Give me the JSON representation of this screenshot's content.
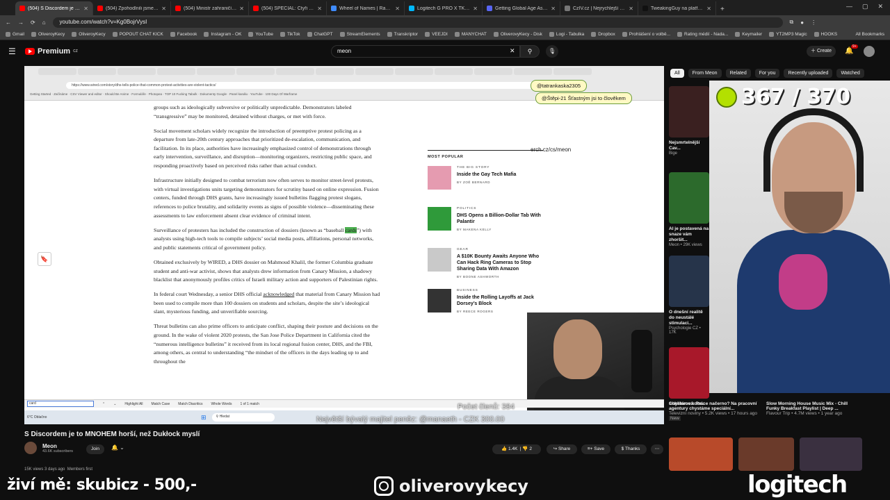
{
  "browser": {
    "tabs": [
      {
        "title": "(504) S Discordem je to MNOHEM horší",
        "color": "#ff0000"
      },
      {
        "title": "(504) Zpohodlnili jsme a rodiči...",
        "color": "#ff0000"
      },
      {
        "title": "(504) Ministr zahraničí Petr Mac...",
        "color": "#ff0000"
      },
      {
        "title": "(504) SPECIÁL: Čtyři roky války...",
        "color": "#ff0000"
      },
      {
        "title": "Wheel of Names | Random nam...",
        "color": "#3f8cff"
      },
      {
        "title": "Logitech G PRO X TKL Rapid, b...",
        "color": "#00b8fc"
      },
      {
        "title": "Getting Global Age Assurance...",
        "color": "#5865f2"
      },
      {
        "title": "CzIV.cz | Nejrychlejší ScreenSh...",
        "color": "#777777"
      },
      {
        "title": "TweakingGuy na platformě X: „...",
        "color": "#111111"
      }
    ],
    "url": "youtube.com/watch?v=Kg0BojrVysI",
    "bookmarks": [
      "Gmail",
      "OliveroyKecy",
      "OliveroyKecy",
      "POPOUT CHAT KICK",
      "Facebook",
      "Instagram - OK",
      "YouTube",
      "TikTok",
      "ChatGPT",
      "StreamElements",
      "Transkriptor",
      "VEEJDI",
      "MANYCHAT",
      "OliverovyKecy - Disk",
      "Logi - Tabulka",
      "Dropbox",
      "Prohlášení o volbě...",
      "Rating médií - Nada...",
      "Keymailer",
      "YT2MP3 Magic",
      "HOOKS"
    ],
    "all_bookmarks": "All Bookmarks"
  },
  "youtube": {
    "logo": "Premium",
    "logo_sup": "CZ",
    "search_value": "meon",
    "create_label": "Create",
    "notif_count": "9+",
    "chips": [
      "All",
      "From Meon",
      "Related",
      "For you",
      "Recently uploaded",
      "Watched"
    ]
  },
  "inner": {
    "url": "https://www.wired.com/story/dhs-tells-police-that-common-protest-activities-are-violent-tactics/",
    "overlay_tag": "erch.cz/cs/meon",
    "chat1": "@tatrankaska2305",
    "chat2": "@Štěpi-21 Šťastným jsi to člověkem",
    "find_value": "card",
    "find_labels": [
      "Highlight All",
      "Match Case",
      "Match Diacritics",
      "Whole Words",
      "1 of 1 match"
    ],
    "taskbar_search": "Hledat",
    "weather": "6°C Oblačno"
  },
  "article": {
    "p0": "groups such as ideologically subversive or politically unpredictable. Demonstrators labeled “transgressive” may be monitored, detained without charges, or met with force.",
    "p1": "Social movement scholars widely recognize the introduction of preemptive protest policing as a departure from late-20th century approaches that prioritized de-escalation, communication, and facilitation. In its place, authorities have increasingly emphasized control of demonstrations through early intervention, surveillance, and disruption—monitoring organizers, restricting public space, and responding proactively based on perceived risks rather than actual conduct.",
    "p2": "Infrastructure initially designed to combat terrorism now often serves to monitor street-level protests, with virtual investigations units targeting demonstrators for scrutiny based on online expression. Fusion centers, funded through DHS grants, have increasingly issued bulletins flagging protest slogans, references to police brutality, and solidarity events as signs of possible violence—disseminating these assessments to law enforcement absent clear evidence of criminal intent.",
    "p3a": "Surveillance of protesters has included the construction of dossiers (known as “baseball ",
    "p3hl": "cards",
    "p3b": "”) with analysts using high-tech tools to compile subjects’ social media posts, affiliations, personal networks, and public statements critical of government policy.",
    "p4": "Obtained exclusively by WIRED, a DHS dossier on Mahmoud Khalil, the former Columbia graduate student and anti-war activist, shows that analysts drew information from Canary Mission, a shadowy blacklist that anonymously profiles critics of Israeli military action and supporters of Palestinian rights.",
    "p5a": "In federal court Wednesday, a senior DHS official ",
    "p5link": "acknowledged",
    "p5b": " that material from Canary Mission had been used to compile more than 100 dossiers on students and scholars, despite the site’s ideological slant, mysterious funding, and unverifiable sourcing.",
    "p6": "Threat bulletins can also prime officers to anticipate conflict, shaping their posture and decisions on the ground. In the wake of violent 2020 protests, the San Jose Police Department in California cited the “numerous intelligence bulletins” it received from its local regional fusion center, DHS, and the FBI, among others, as central to understanding “the mindset of the officers in the days leading up to and throughout the"
  },
  "most_popular": {
    "heading": "MOST POPULAR",
    "items": [
      {
        "cat": "THE BIG STORY",
        "title": "Inside the Gay Tech Mafia",
        "by": "BY ZOË BERNARD",
        "color": "#e59bb0"
      },
      {
        "cat": "POLITICS",
        "title": "DHS Opens a Billion-Dollar Tab With Palantir",
        "by": "BY MAKENA KELLY",
        "color": "#2f9a3a"
      },
      {
        "cat": "GEAR",
        "title": "A $10K Bounty Awaits Anyone Who Can Hack Ring Cameras to Stop Sharing Data With Amazon",
        "by": "BY BOONE ASHWORTH",
        "color": "#c9c9c9"
      },
      {
        "cat": "BUSINESS",
        "title": "Inside the Rolling Layoffs at Jack Dorsey’s Block",
        "by": "BY REECE ROGERS",
        "color": "#333333"
      }
    ]
  },
  "stream_overlay": {
    "counter": "367 / 370",
    "members": "Počet členů: 384",
    "donation": "Největší bývalý majitel peněz: @manaeth - CZK 300.00",
    "donor_line": "živí mě: skubicz - 500,-",
    "instagram": "oliverovykecy",
    "sponsor": "logitech"
  },
  "recs": [
    {
      "title": "Nejsmrtelnější Cav...",
      "meta": "Bige",
      "color": "#3a2020"
    },
    {
      "title": "AI je postavená na snaze vám zhoršit...",
      "meta": "Meon • 29K views",
      "color": "#2c6a2c"
    },
    {
      "title": "O dnešní realitě do neustálé stimulaci...",
      "meta": "Psychologie CZ • 17K",
      "color": "#26344a"
    },
    {
      "title": "Chystáme kobru",
      "meta": "",
      "color": "#a8182a"
    }
  ],
  "recs_bottom": [
    {
      "title": "Schillerová: Práce načerno? Na pracovní agentury chystáme speciální...",
      "meta": "Televizní noviny • 5.2K views • 17 hours ago",
      "badge": "New"
    },
    {
      "title": "Slow Morning House Music Mix - Chill Funky Breakfast Playlist | Deep ...",
      "meta": "Flavour Trip • 4.7M views • 1 year ago"
    }
  ],
  "video": {
    "title": "S Discordem je to MNOHEM horší, než Dukłock myslí",
    "channel": "Meon",
    "subs": "43.6K subscribers",
    "join": "Join",
    "likes": "1.4K",
    "dislikes": "2",
    "share": "Share",
    "save": "Save",
    "thanks": "Thanks",
    "desc_meta": "15K views  3 days ago",
    "members_first": "Members first"
  }
}
